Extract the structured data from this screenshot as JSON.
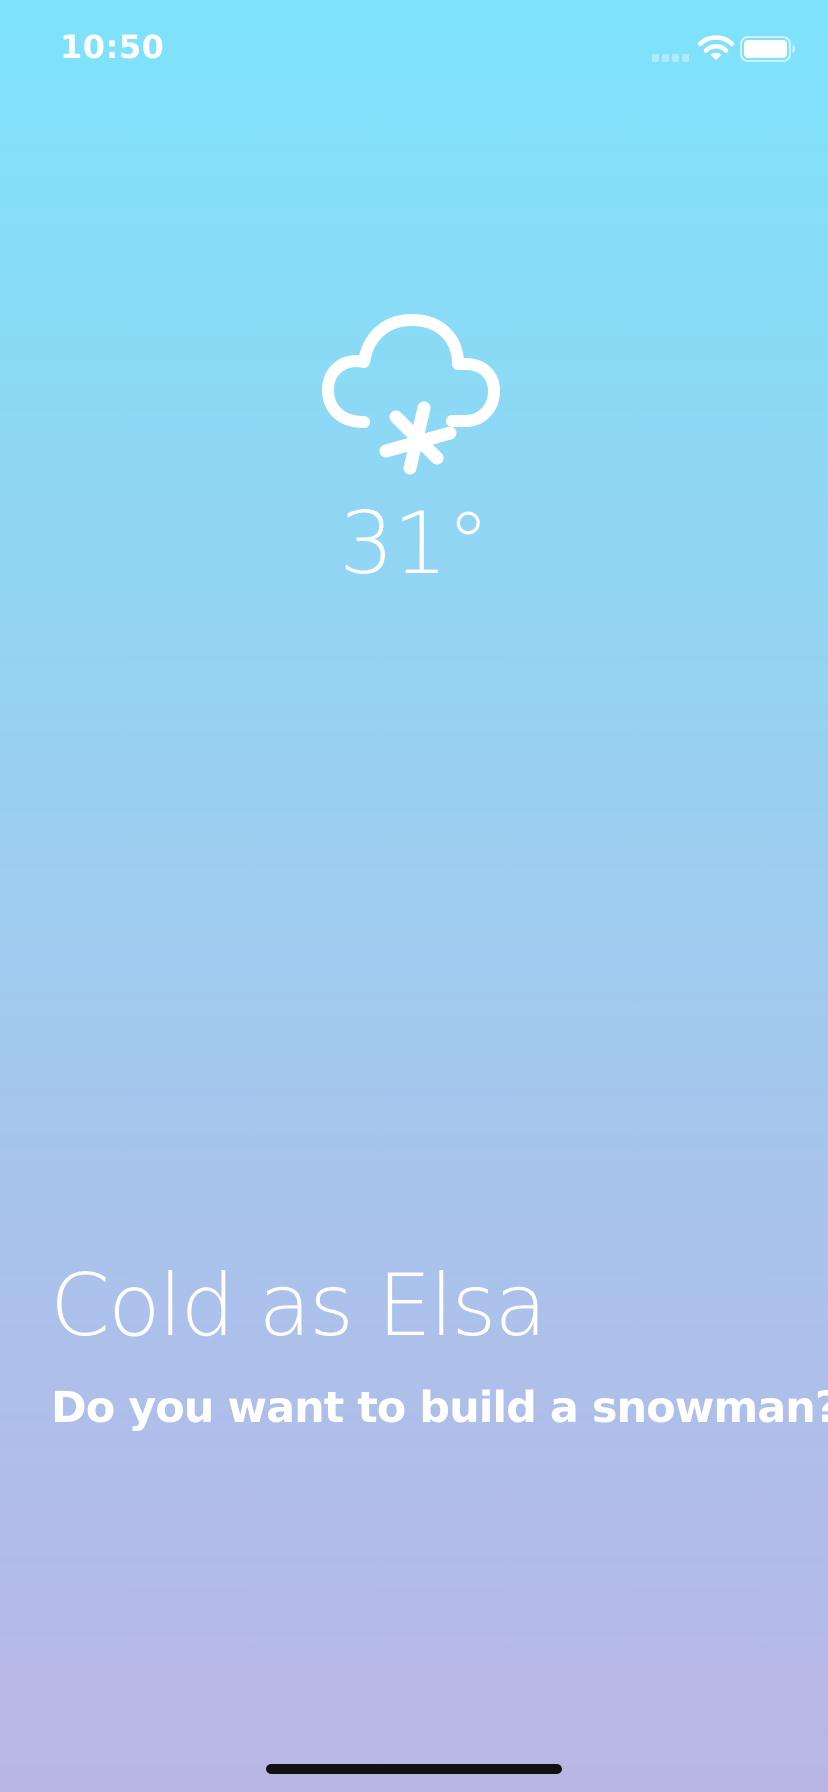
{
  "status_bar": {
    "time": "10:50",
    "icons": [
      "signal-icon",
      "wifi-icon",
      "battery-icon"
    ]
  },
  "weather": {
    "icon": "snow-cloud-icon",
    "temperature": "31°"
  },
  "message": {
    "headline": "Cold as Elsa",
    "subline": "Do you want to build a snowman?"
  },
  "colors": {
    "background_top": "#7ee3fb",
    "background_bottom": "#b9b6e5",
    "text": "#ffffff",
    "home_indicator": "#111111"
  }
}
